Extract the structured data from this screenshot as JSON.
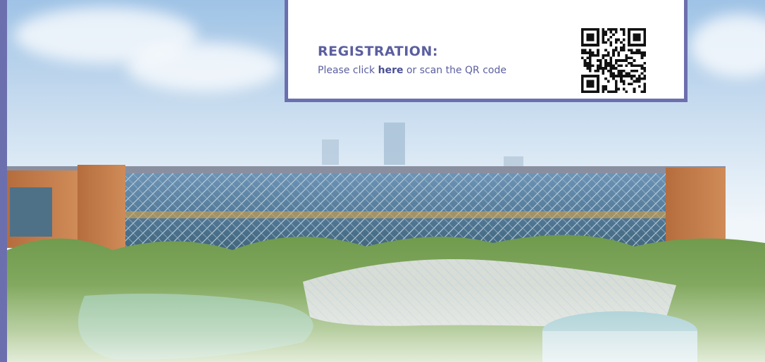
{
  "registration": {
    "title": "REGISTRATION:",
    "text_before": "Please click ",
    "link_label": "here",
    "text_after": " or scan the QR code"
  },
  "colors": {
    "accent": "#6c6fae",
    "text": "#5b5f9f",
    "facade_wood": "#c07a4a"
  },
  "qr_code": {
    "icon": "qr-code-icon"
  },
  "background_photo": {
    "icon": "campus-building-photo"
  }
}
